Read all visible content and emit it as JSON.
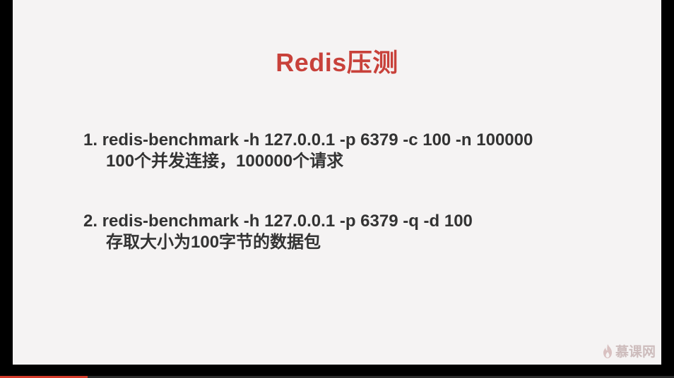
{
  "slide": {
    "title": "Redis压测",
    "items": [
      {
        "command": "1. redis-benchmark -h 127.0.0.1 -p 6379 -c 100 -n 100000",
        "description": "100个并发连接，100000个请求"
      },
      {
        "command": "2. redis-benchmark -h 127.0.0.1 -p 6379 -q -d 100",
        "description": "存取大小为100字节的数据包"
      }
    ]
  },
  "watermark": {
    "text": "慕课网",
    "icon": "flame-logo-icon"
  },
  "colors": {
    "title": "#c8413a",
    "body_text": "#333333",
    "slide_bg": "#f5f3f3",
    "frame_bg": "#000000",
    "progress": "#d23a2a",
    "watermark": "#c9b7b7"
  },
  "video": {
    "progress_fraction": 0.13
  }
}
